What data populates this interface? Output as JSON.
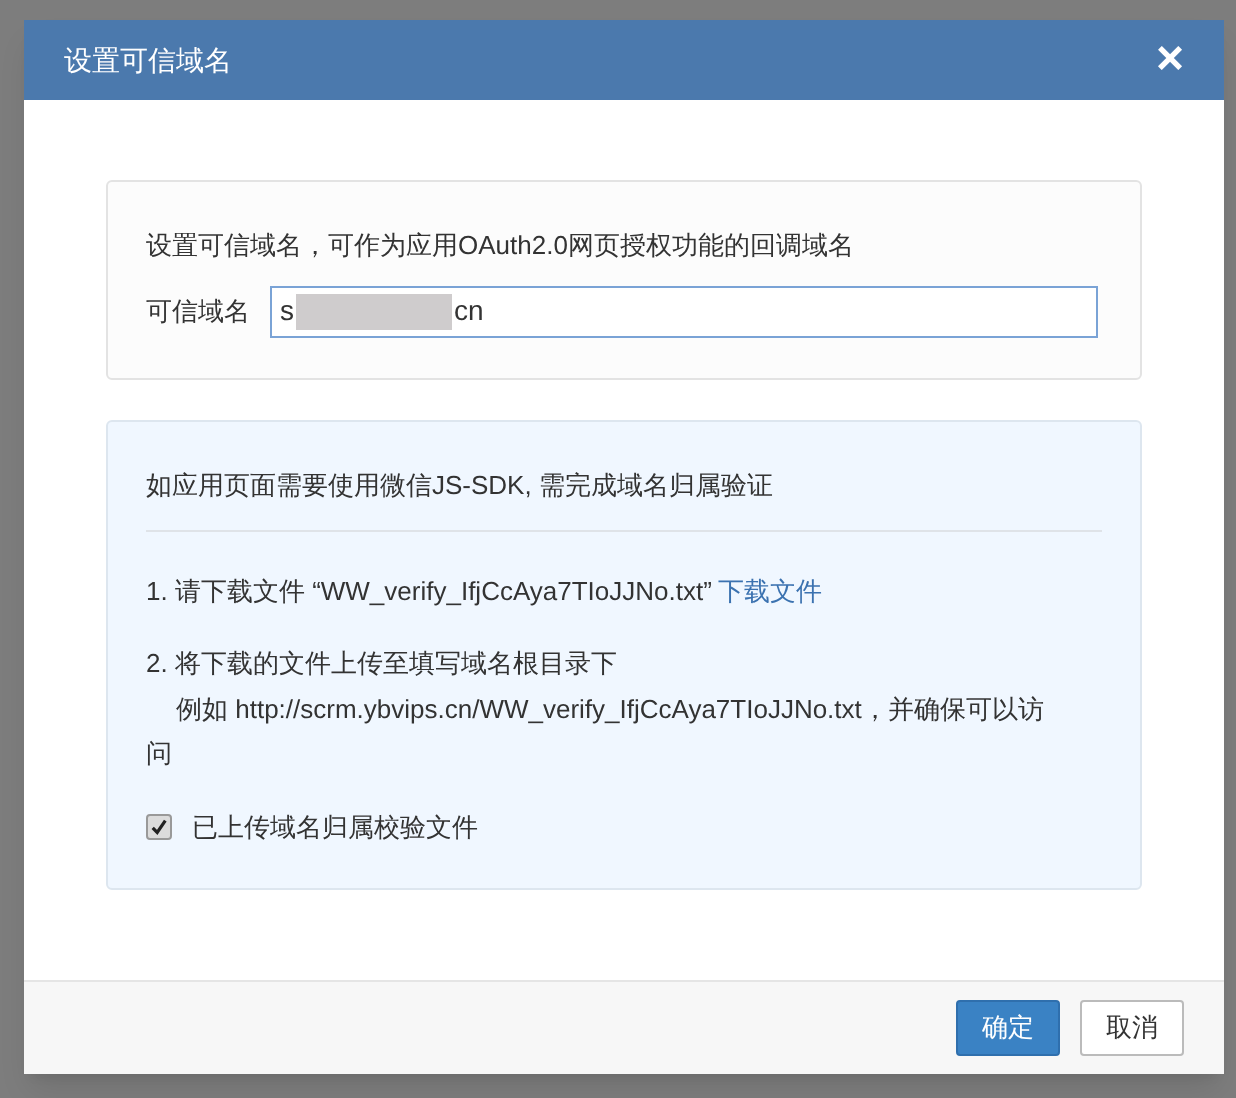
{
  "dialog": {
    "title": "设置可信域名",
    "close": "×",
    "domain_card": {
      "description": "设置可信域名，可作为应用OAuth2.0网页授权功能的回调域名",
      "label": "可信域名",
      "value_prefix": "s",
      "value_suffix": "cn",
      "redacted": true
    },
    "verify_card": {
      "heading": "如应用页面需要使用微信JS-SDK, 需完成域名归属验证",
      "step_1": "1. 请下载文件 “WW_verify_IfjCcAya7TIoJJNo.txt”",
      "download_link": "下载文件",
      "step_2": "2. 将下载的文件上传至填写域名根目录下",
      "example": "例如 http://scrm.ybvips.cn/WW_verify_IfjCcAya7TIoJJNo.txt，并确保可以访问",
      "checkbox": {
        "label": "已上传域名归属校验文件",
        "checked": true
      }
    },
    "buttons": [
      {
        "label": "确定",
        "kind": "primary"
      },
      {
        "label": "取消",
        "kind": "default"
      }
    ]
  }
}
